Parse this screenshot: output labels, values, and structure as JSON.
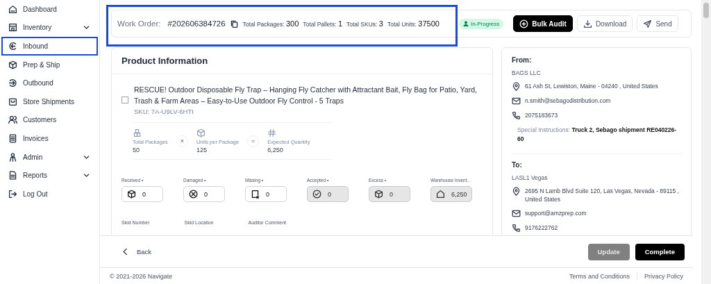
{
  "sidebar": {
    "items": [
      {
        "label": "Dashboard",
        "has_submenu": false,
        "highlighted": false
      },
      {
        "label": "Inventory",
        "has_submenu": true,
        "highlighted": false
      },
      {
        "label": "Inbound",
        "has_submenu": false,
        "highlighted": true
      },
      {
        "label": "Prep & Ship",
        "has_submenu": false,
        "highlighted": false
      },
      {
        "label": "Outbound",
        "has_submenu": false,
        "highlighted": false
      },
      {
        "label": "Store Shipments",
        "has_submenu": false,
        "highlighted": false
      },
      {
        "label": "Customers",
        "has_submenu": false,
        "highlighted": false
      },
      {
        "label": "Invoices",
        "has_submenu": false,
        "highlighted": false
      },
      {
        "label": "Admin",
        "has_submenu": true,
        "highlighted": false
      },
      {
        "label": "Reports",
        "has_submenu": true,
        "highlighted": false
      },
      {
        "label": "Log Out",
        "has_submenu": false,
        "highlighted": false
      }
    ]
  },
  "header": {
    "highlighted": true,
    "work_order_label": "Work Order:",
    "work_order_number": "#202606384726",
    "stats": [
      {
        "label": "Total Packages:",
        "value": "300"
      },
      {
        "label": "Total Pallets:",
        "value": "1"
      },
      {
        "label": "Total SKUs:",
        "value": "3"
      },
      {
        "label": "Total Units:",
        "value": "37500"
      }
    ],
    "status": "In-Progress",
    "buttons": [
      {
        "label": "Bulk Audit",
        "kind": "primary"
      },
      {
        "label": "Download",
        "kind": "download"
      },
      {
        "label": "Send",
        "kind": "send"
      }
    ]
  },
  "product": {
    "title": "Product Information",
    "name": "RESCUE! Outdoor Disposable Fly Trap – Hanging Fly Catcher with Attractant Bait, Fly Bag for Patio, Yard, Trash & Farm Areas – Easy-to-Use Outdoor Fly Control - 5 Traps",
    "sku": "SKU: 7A-U9LV-6HTI",
    "metrics": [
      {
        "label": "Total Packages",
        "value": "50",
        "operator": "×"
      },
      {
        "label": "Units per Package",
        "value": "125",
        "operator": "="
      },
      {
        "label": "Expected Quantity",
        "value": "6,250"
      }
    ],
    "fields": [
      {
        "label": "Received •",
        "value": "0",
        "readonly": false
      },
      {
        "label": "Damaged •",
        "value": "0",
        "readonly": false
      },
      {
        "label": "Missing •",
        "value": "0",
        "readonly": false
      },
      {
        "label": "Accepted •",
        "value": "0",
        "readonly": true
      },
      {
        "label": "Excess •",
        "value": "0",
        "readonly": true
      },
      {
        "label": "Warehouse Invent…",
        "value": "6,250",
        "readonly": true
      }
    ],
    "lower_labels": [
      "Skid Number",
      "Skid Location",
      "Auditor Comment"
    ]
  },
  "addresses": [
    {
      "heading": "From:",
      "name": "BAGS LLC",
      "address": "61 Ash St, Lewiston, Maine - 04240 , United States",
      "email": "n.smith@sebagodistribution.com",
      "phone": "2075183673",
      "instructions_label": "Special Instructions:",
      "instructions": "Truck 2, Sebago shipment RE040226-60"
    },
    {
      "heading": "To:",
      "name": "LASL1 Vegas",
      "address": "2695 N Lamb Blvd Suite 120, Las Vegas, Nevada - 89115 , United States",
      "email": "support@amzprep.com",
      "phone": "9176222762"
    }
  ],
  "actions": {
    "back": "Back",
    "buttons": [
      {
        "label": "Update",
        "disabled": true
      },
      {
        "label": "Complete",
        "disabled": false
      }
    ]
  },
  "footer": {
    "copyright": "© 2021-2026 Navigate",
    "links": [
      "Terms and Conditions",
      "Privacy Policy"
    ]
  }
}
